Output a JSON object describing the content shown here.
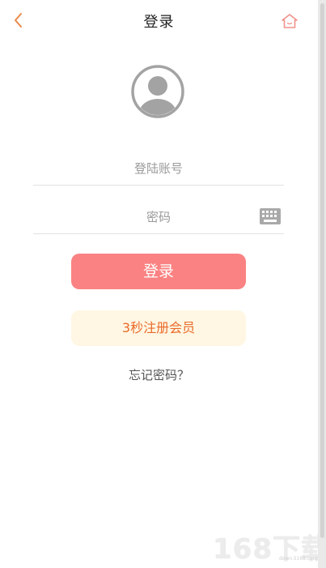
{
  "header": {
    "title": "登录",
    "back_icon": "chevron-left-icon",
    "home_icon": "home-icon"
  },
  "avatar": {
    "icon": "user-avatar-icon"
  },
  "form": {
    "account_placeholder": "登陆账号",
    "password_placeholder": "密码",
    "keyboard_icon": "keyboard-icon"
  },
  "buttons": {
    "login_label": "登录",
    "register_label": "3秒注册会员"
  },
  "links": {
    "forgot_password": "忘记密码？"
  },
  "watermark": {
    "logo_text": "168下载",
    "url": "down.li168.com"
  },
  "colors": {
    "accent_orange": "#e98a4a",
    "login_bg": "#fa8282",
    "register_bg": "#fff7e3",
    "register_text": "#e96a2a"
  }
}
